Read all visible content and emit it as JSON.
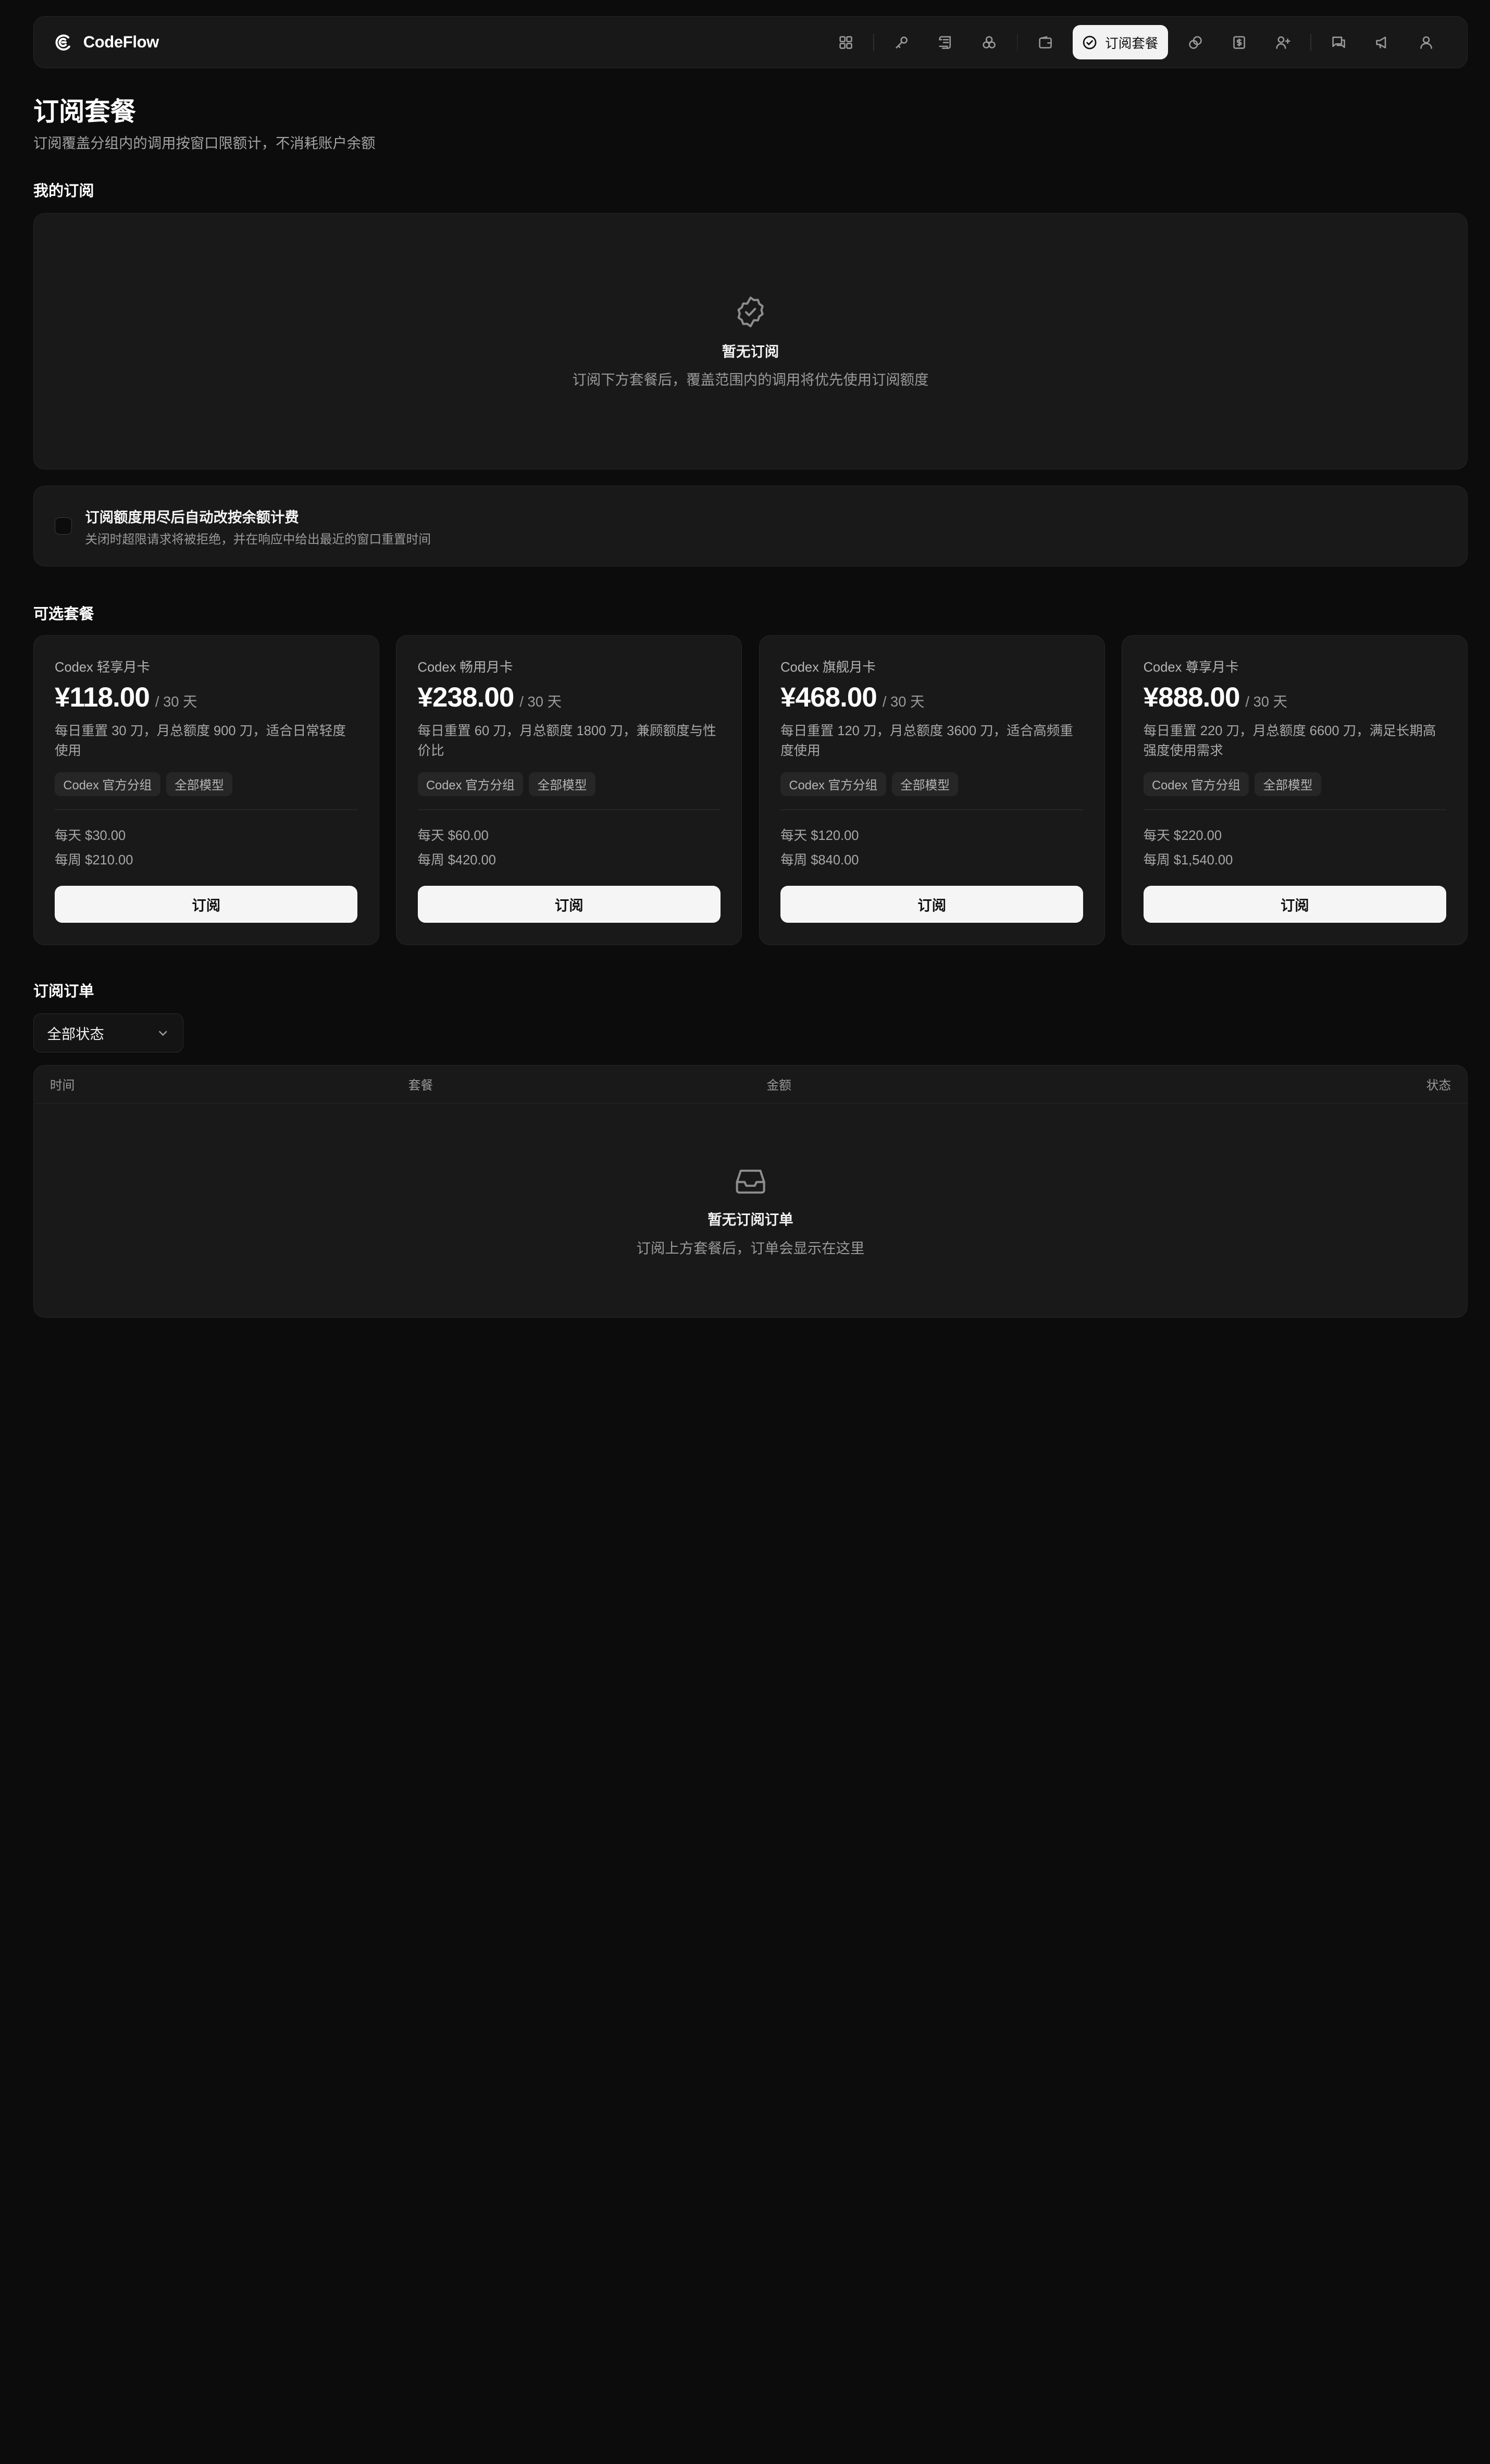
{
  "brand": {
    "name": "CodeFlow",
    "logo_icon": "codeflow-logo-icon"
  },
  "nav": {
    "icons": [
      "dashboard-icon",
      "key-icon",
      "logs-icon",
      "models-icon",
      "wallet-icon",
      "subscription-icon",
      "link-icon",
      "billing-icon",
      "invite-user-icon",
      "chat-icon",
      "announcement-icon",
      "profile-icon"
    ],
    "active_label": "订阅套餐"
  },
  "page": {
    "title": "订阅套餐",
    "subtitle": "订阅覆盖分组内的调用按窗口限额计，不消耗账户余额"
  },
  "my_subscription": {
    "section_title": "我的订阅",
    "empty_title": "暂无订阅",
    "empty_desc": "订阅下方套餐后，覆盖范围内的调用将优先使用订阅额度"
  },
  "fallback_toggle": {
    "checked": false,
    "title": "订阅额度用尽后自动改按余额计费",
    "desc": "关闭时超限请求将被拒绝，并在响应中给出最近的窗口重置时间"
  },
  "plans_section": {
    "title": "可选套餐",
    "subscribe_label": "订阅",
    "plans": [
      {
        "name": "Codex 轻享月卡",
        "price": "¥118.00",
        "period": "/ 30 天",
        "desc": "每日重置 30 刀，月总额度 900 刀，适合日常轻度使用",
        "tags": [
          "Codex 官方分组",
          "全部模型"
        ],
        "daily": "每天 $30.00",
        "weekly": "每周 $210.00"
      },
      {
        "name": "Codex 畅用月卡",
        "price": "¥238.00",
        "period": "/ 30 天",
        "desc": "每日重置 60 刀，月总额度 1800 刀，兼顾额度与性价比",
        "tags": [
          "Codex 官方分组",
          "全部模型"
        ],
        "daily": "每天 $60.00",
        "weekly": "每周 $420.00"
      },
      {
        "name": "Codex 旗舰月卡",
        "price": "¥468.00",
        "period": "/ 30 天",
        "desc": "每日重置 120 刀，月总额度 3600 刀，适合高频重度使用",
        "tags": [
          "Codex 官方分组",
          "全部模型"
        ],
        "daily": "每天 $120.00",
        "weekly": "每周 $840.00"
      },
      {
        "name": "Codex 尊享月卡",
        "price": "¥888.00",
        "period": "/ 30 天",
        "desc": "每日重置 220 刀，月总额度 6600 刀，满足长期高强度使用需求",
        "tags": [
          "Codex 官方分组",
          "全部模型"
        ],
        "daily": "每天 $220.00",
        "weekly": "每周 $1,540.00"
      }
    ]
  },
  "orders": {
    "section_title": "订阅订单",
    "filter_value": "全部状态",
    "columns": [
      "时间",
      "套餐",
      "金额",
      "状态"
    ],
    "empty_title": "暂无订阅订单",
    "empty_desc": "订阅上方套餐后，订单会显示在这里"
  }
}
